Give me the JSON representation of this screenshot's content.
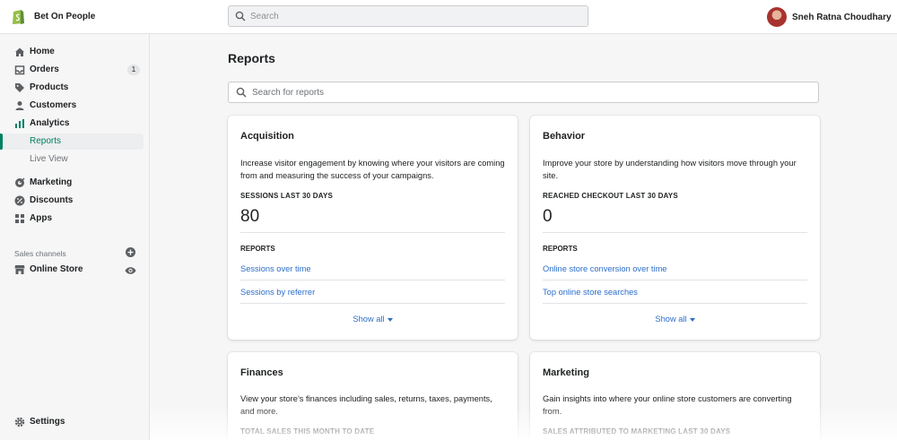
{
  "topbar": {
    "store_name": "Bet On People",
    "search_placeholder": "Search",
    "user_name": "Sneh Ratna Choudhary"
  },
  "sidebar": {
    "items": [
      {
        "label": "Home",
        "icon": "home-icon"
      },
      {
        "label": "Orders",
        "icon": "orders-icon",
        "badge": "1"
      },
      {
        "label": "Products",
        "icon": "tag-icon"
      },
      {
        "label": "Customers",
        "icon": "person-icon"
      },
      {
        "label": "Analytics",
        "icon": "bar-chart-icon"
      },
      {
        "label": "Reports",
        "active": true
      },
      {
        "label": "Live View"
      },
      {
        "label": "Marketing",
        "icon": "marketing-icon"
      },
      {
        "label": "Discounts",
        "icon": "discount-icon"
      },
      {
        "label": "Apps",
        "icon": "apps-icon"
      }
    ],
    "sales_channels_label": "Sales channels",
    "online_store_label": "Online Store",
    "settings_label": "Settings"
  },
  "main": {
    "page_title": "Reports",
    "search_placeholder": "Search for reports",
    "cards": [
      {
        "title": "Acquisition",
        "description": "Increase visitor engagement by knowing where your visitors are coming from and measuring the success of your campaigns.",
        "metric_label": "SESSIONS LAST 30 DAYS",
        "metric_value": "80",
        "reports_label": "REPORTS",
        "links": [
          "Sessions over time",
          "Sessions by referrer"
        ],
        "show_all": "Show all"
      },
      {
        "title": "Behavior",
        "description": "Improve your store by understanding how visitors move through your site.",
        "metric_label": "REACHED CHECKOUT LAST 30 DAYS",
        "metric_value": "0",
        "reports_label": "REPORTS",
        "links": [
          "Online store conversion over time",
          "Top online store searches"
        ],
        "show_all": "Show all"
      },
      {
        "title": "Finances",
        "description": "View your store’s finances including sales, returns, taxes, payments, and more.",
        "metric_label": "TOTAL SALES THIS MONTH TO DATE"
      },
      {
        "title": "Marketing",
        "description": "Gain insights into where your online store customers are converting from.",
        "metric_label": "SALES ATTRIBUTED TO MARKETING LAST 30 DAYS"
      }
    ]
  },
  "colors": {
    "accent": "#008060",
    "link": "#2c6ecb",
    "background": "#f6f6f7",
    "brand_logo": "#95bf47"
  }
}
